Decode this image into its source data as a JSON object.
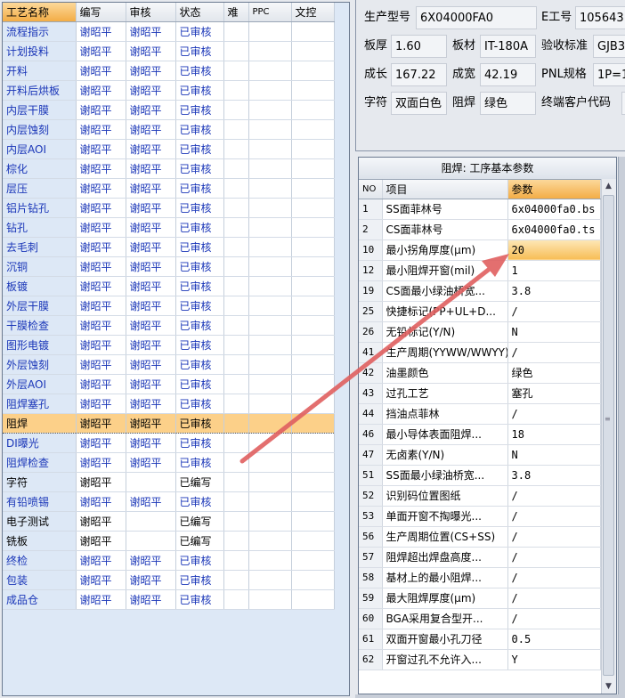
{
  "process_table": {
    "headers": [
      "工艺名称",
      "编写",
      "审核",
      "状态",
      "难",
      "PPC",
      "文控"
    ],
    "rows": [
      {
        "name": "流程指示",
        "writer": "谢昭平",
        "reviewer": "谢昭平",
        "status": "已审核"
      },
      {
        "name": "计划投料",
        "writer": "谢昭平",
        "reviewer": "谢昭平",
        "status": "已审核"
      },
      {
        "name": "开料",
        "writer": "谢昭平",
        "reviewer": "谢昭平",
        "status": "已审核"
      },
      {
        "name": "开料后烘板",
        "writer": "谢昭平",
        "reviewer": "谢昭平",
        "status": "已审核"
      },
      {
        "name": "内层干膜",
        "writer": "谢昭平",
        "reviewer": "谢昭平",
        "status": "已审核"
      },
      {
        "name": "内层蚀刻",
        "writer": "谢昭平",
        "reviewer": "谢昭平",
        "status": "已审核"
      },
      {
        "name": "内层AOI",
        "writer": "谢昭平",
        "reviewer": "谢昭平",
        "status": "已审核"
      },
      {
        "name": "棕化",
        "writer": "谢昭平",
        "reviewer": "谢昭平",
        "status": "已审核"
      },
      {
        "name": "层压",
        "writer": "谢昭平",
        "reviewer": "谢昭平",
        "status": "已审核"
      },
      {
        "name": "铝片钻孔",
        "writer": "谢昭平",
        "reviewer": "谢昭平",
        "status": "已审核"
      },
      {
        "name": "钻孔",
        "writer": "谢昭平",
        "reviewer": "谢昭平",
        "status": "已审核"
      },
      {
        "name": "去毛刺",
        "writer": "谢昭平",
        "reviewer": "谢昭平",
        "status": "已审核"
      },
      {
        "name": "沉铜",
        "writer": "谢昭平",
        "reviewer": "谢昭平",
        "status": "已审核"
      },
      {
        "name": "板镀",
        "writer": "谢昭平",
        "reviewer": "谢昭平",
        "status": "已审核"
      },
      {
        "name": "外层干膜",
        "writer": "谢昭平",
        "reviewer": "谢昭平",
        "status": "已审核"
      },
      {
        "name": "干膜检查",
        "writer": "谢昭平",
        "reviewer": "谢昭平",
        "status": "已审核"
      },
      {
        "name": "图形电镀",
        "writer": "谢昭平",
        "reviewer": "谢昭平",
        "status": "已审核"
      },
      {
        "name": "外层蚀刻",
        "writer": "谢昭平",
        "reviewer": "谢昭平",
        "status": "已审核"
      },
      {
        "name": "外层AOI",
        "writer": "谢昭平",
        "reviewer": "谢昭平",
        "status": "已审核"
      },
      {
        "name": "阻焊塞孔",
        "writer": "谢昭平",
        "reviewer": "谢昭平",
        "status": "已审核"
      },
      {
        "name": "阻焊",
        "writer": "谢昭平",
        "reviewer": "谢昭平",
        "status": "已审核",
        "selected": true
      },
      {
        "name": "DI曝光",
        "writer": "谢昭平",
        "reviewer": "谢昭平",
        "status": "已审核"
      },
      {
        "name": "阻焊检查",
        "writer": "谢昭平",
        "reviewer": "谢昭平",
        "status": "已审核"
      },
      {
        "name": "字符",
        "writer": "谢昭平",
        "reviewer": "",
        "status": "已编写",
        "black": true
      },
      {
        "name": "有铅喷锡",
        "writer": "谢昭平",
        "reviewer": "谢昭平",
        "status": "已审核"
      },
      {
        "name": "电子测试",
        "writer": "谢昭平",
        "reviewer": "",
        "status": "已编写",
        "black": true
      },
      {
        "name": "铣板",
        "writer": "谢昭平",
        "reviewer": "",
        "status": "已编写",
        "black": true
      },
      {
        "name": "终检",
        "writer": "谢昭平",
        "reviewer": "谢昭平",
        "status": "已审核"
      },
      {
        "name": "包装",
        "writer": "谢昭平",
        "reviewer": "谢昭平",
        "status": "已审核"
      },
      {
        "name": "成品仓",
        "writer": "谢昭平",
        "reviewer": "谢昭平",
        "status": "已审核"
      }
    ]
  },
  "info": {
    "model_label": "生产型号",
    "model_value": "6X04000FA0",
    "e_no_label": "E工号",
    "e_no_value": "105643",
    "thickness_label": "板厚",
    "thickness_value": "1.60",
    "material_label": "板材",
    "material_value": "IT-180A",
    "standard_label": "验收标准",
    "standard_value": "GJB3",
    "length_label": "成长",
    "length_value": "167.22",
    "width_label": "成宽",
    "width_value": "42.19",
    "pnl_label": "PNL规格",
    "pnl_value": "1P=1",
    "char_label": "字符",
    "char_value": "双面白色",
    "mask_label": "阻焊",
    "mask_value": "绿色",
    "customer_label": "终端客户代码"
  },
  "params": {
    "title": "阻焊: 工序基本参数",
    "headers": [
      "NO",
      "项目",
      "参数"
    ],
    "rows": [
      {
        "no": "1",
        "item": "SS面菲林号",
        "value": "6x04000fa0.bs"
      },
      {
        "no": "2",
        "item": "CS面菲林号",
        "value": "6x04000fa0.ts"
      },
      {
        "no": "10",
        "item": "最小拐角厚度(μm)",
        "value": "20",
        "selected": true
      },
      {
        "no": "12",
        "item": "最小阻焊开窗(mil)",
        "value": "1"
      },
      {
        "no": "19",
        "item": "CS面最小绿油桥宽...",
        "value": "3.8"
      },
      {
        "no": "25",
        "item": "快捷标记(PP+UL+D...",
        "value": "/"
      },
      {
        "no": "26",
        "item": "无铅标记(Y/N)",
        "value": "N"
      },
      {
        "no": "41",
        "item": "生产周期(YYWW/WWYY)",
        "value": "/"
      },
      {
        "no": "42",
        "item": "油墨颜色",
        "value": "绿色"
      },
      {
        "no": "43",
        "item": "过孔工艺",
        "value": "塞孔"
      },
      {
        "no": "44",
        "item": "挡油点菲林",
        "value": "/"
      },
      {
        "no": "46",
        "item": "最小导体表面阻焊...",
        "value": "18"
      },
      {
        "no": "47",
        "item": "无卤素(Y/N)",
        "value": "N"
      },
      {
        "no": "51",
        "item": "SS面最小绿油桥宽...",
        "value": "3.8"
      },
      {
        "no": "52",
        "item": "识别码位置图纸",
        "value": "/"
      },
      {
        "no": "53",
        "item": "单面开窗不掏曝光...",
        "value": "/"
      },
      {
        "no": "56",
        "item": "生产周期位置(CS+SS)",
        "value": "/"
      },
      {
        "no": "57",
        "item": "阻焊超出焊盘高度...",
        "value": "/"
      },
      {
        "no": "58",
        "item": "基材上的最小阻焊...",
        "value": "/"
      },
      {
        "no": "59",
        "item": "最大阻焊厚度(μm)",
        "value": "/"
      },
      {
        "no": "60",
        "item": "BGA采用复合型开...",
        "value": "/"
      },
      {
        "no": "61",
        "item": "双面开窗最小孔刀径",
        "value": "0.5"
      },
      {
        "no": "62",
        "item": "开窗过孔不允许入...",
        "value": "Y"
      }
    ]
  },
  "colors": {
    "selection": "#fcd089",
    "link_text": "#1a36b8",
    "annotation_arrow": "#e06060"
  },
  "icons": {
    "scroll_up": "triangle-up-icon",
    "scroll_down": "triangle-down-icon",
    "annotation": "red-arrow-icon"
  }
}
